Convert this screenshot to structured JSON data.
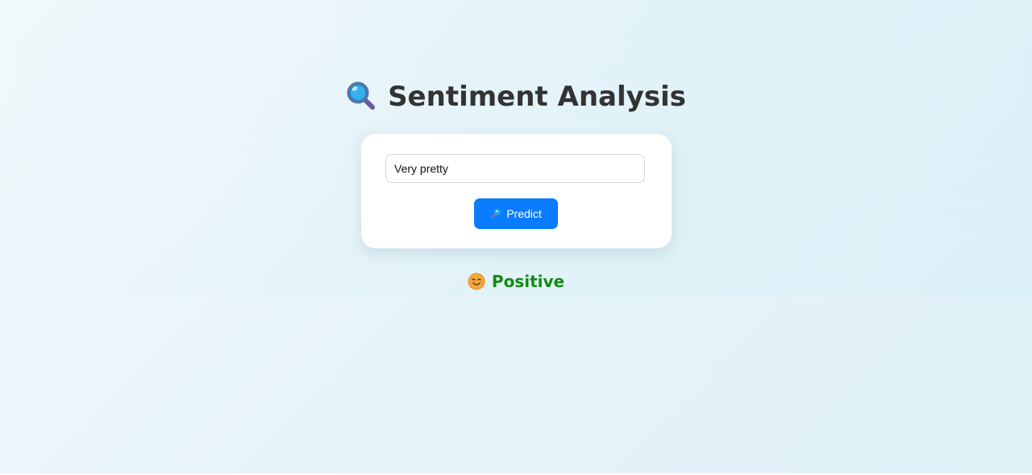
{
  "app": {
    "title": "Sentiment Analysis",
    "title_icon": "magnifying-glass-icon"
  },
  "form": {
    "input_value": "Very pretty",
    "input_placeholder": "",
    "button_label": "Predict",
    "button_icon": "magnifying-glass-icon"
  },
  "result": {
    "label": "Positive",
    "icon": "smiling-face-icon",
    "color": "#138a13"
  },
  "colors": {
    "accent": "#0a7cff",
    "title_text": "#333333",
    "positive": "#138a13"
  }
}
